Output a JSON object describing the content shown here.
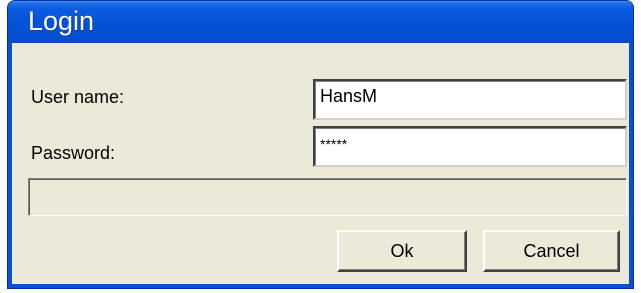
{
  "window": {
    "title": "Login"
  },
  "form": {
    "username_label": "User name:",
    "username_value": "HansM",
    "password_label": "Password:",
    "password_value": "*****",
    "status_text": ""
  },
  "buttons": {
    "ok_label": "Ok",
    "cancel_label": "Cancel"
  },
  "colors": {
    "titlebar": "#0552d8",
    "client": "#ece9d8",
    "title_text": "#ffffff"
  }
}
